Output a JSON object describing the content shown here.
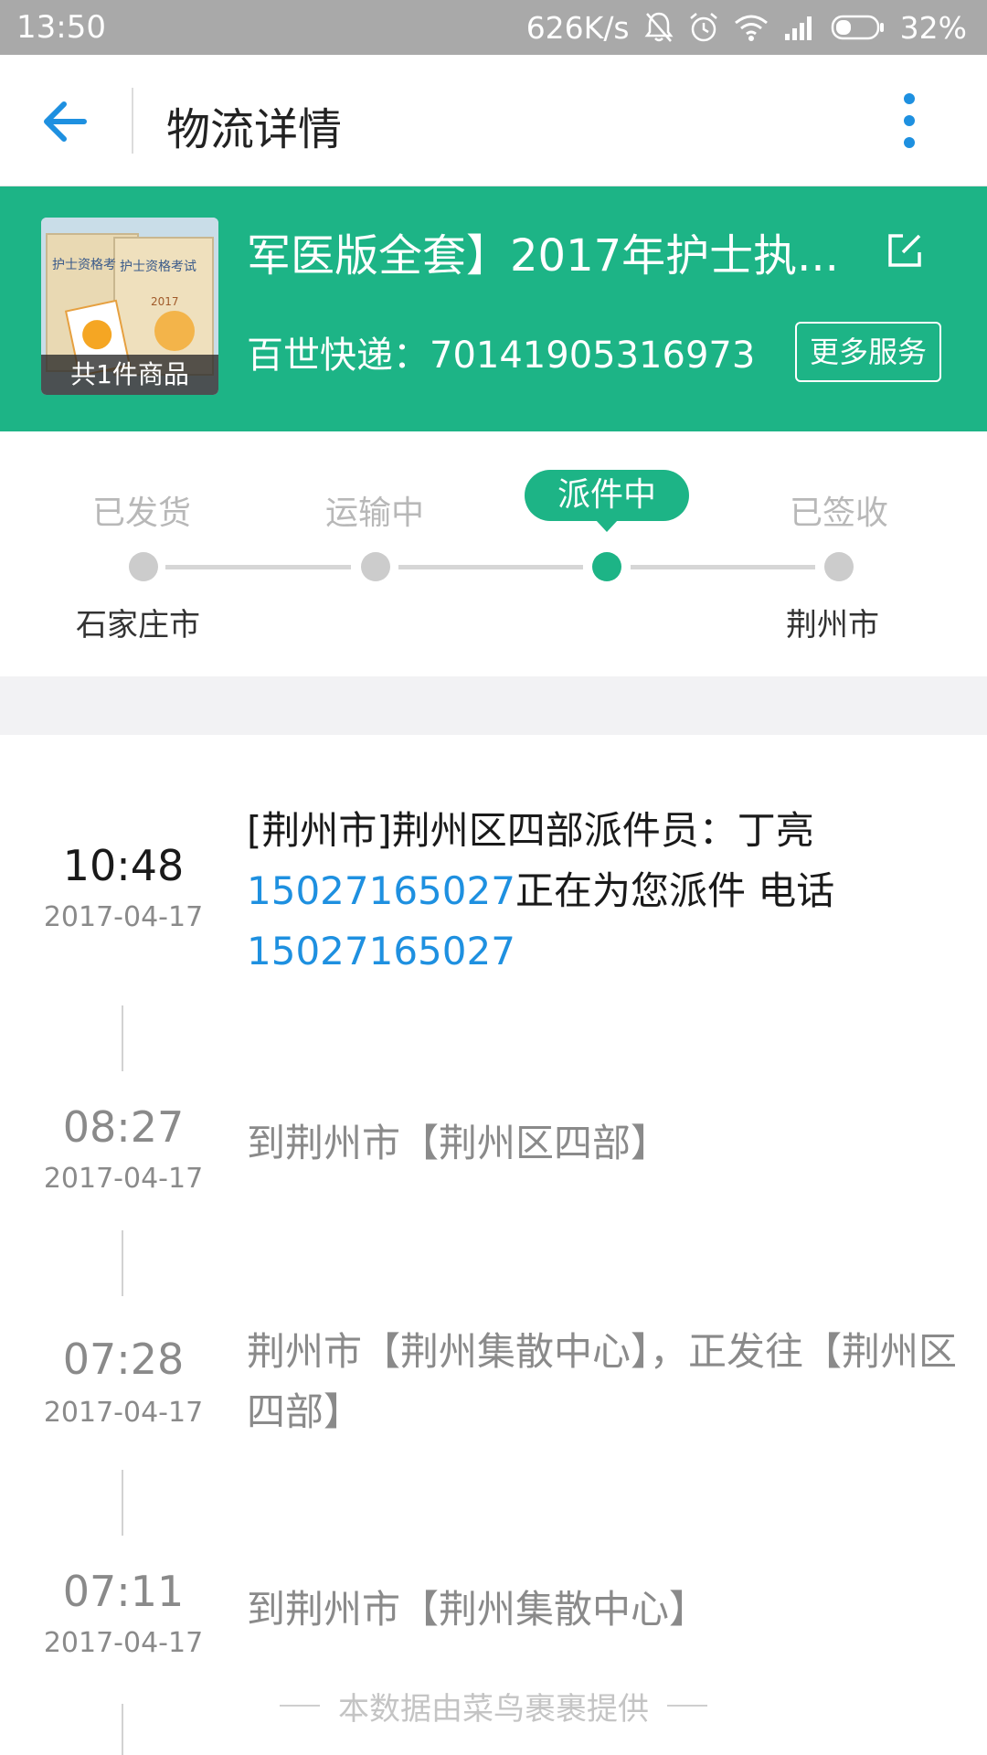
{
  "status_bar": {
    "time": "13:50",
    "net_speed": "626K/s",
    "battery": "32%"
  },
  "header": {
    "title": "物流详情"
  },
  "order": {
    "product_title": "军医版全套】2017年护士执...",
    "item_count_label": "共1件商品",
    "courier_label": "百世快递：",
    "tracking_number": "70141905316973",
    "more_services_label": "更多服务",
    "cover_text_1": "护士资格考",
    "cover_text_2": "护士资格考试",
    "cover_year": "2017"
  },
  "progress": {
    "steps": [
      {
        "label": "已发货"
      },
      {
        "label": "运输中"
      },
      {
        "label": "派件中"
      },
      {
        "label": "已签收"
      }
    ],
    "current_step_index": 2,
    "origin_city": "石家庄市",
    "destination_city": "荆州市"
  },
  "timeline": [
    {
      "time": "10:48",
      "date": "2017-04-17",
      "text_1": "[荆州市]荆州区四部派件员：丁亮",
      "phone_1": "15027165027",
      "text_2": "正在为您派件 电话",
      "phone_2": "15027165027"
    },
    {
      "time": "08:27",
      "date": "2017-04-17",
      "text": "到荆州市【荆州区四部】"
    },
    {
      "time": "07:28",
      "date": "2017-04-17",
      "text": "荆州市【荆州集散中心】，正发往【荆州区四部】"
    },
    {
      "time": "07:11",
      "date": "2017-04-17",
      "text": "到荆州市【荆州集散中心】"
    }
  ],
  "footer": {
    "note": "本数据由菜鸟裹裹提供"
  },
  "colors": {
    "accent_green": "#1db486",
    "link_blue": "#1e90e0",
    "status_bar_gray": "#a9a9a9"
  }
}
